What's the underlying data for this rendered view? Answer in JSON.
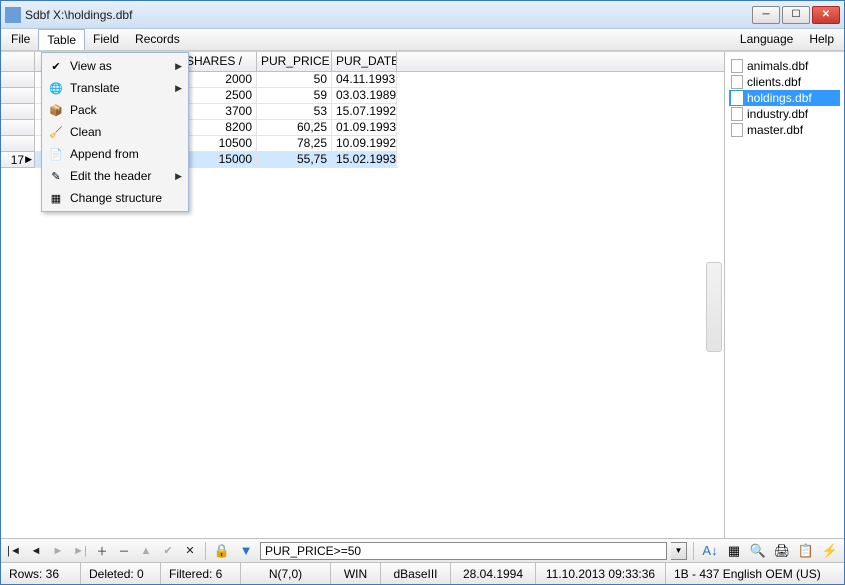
{
  "window": {
    "title": "Sdbf X:\\holdings.dbf"
  },
  "menubar": {
    "file": "File",
    "table": "Table",
    "field": "Field",
    "records": "Records",
    "language": "Language",
    "help": "Help"
  },
  "dropdown": {
    "view_as": "View as",
    "translate": "Translate",
    "pack": "Pack",
    "clean": "Clean",
    "append_from": "Append from",
    "edit_header": "Edit the header",
    "change_structure": "Change structure"
  },
  "grid": {
    "headers": {
      "shares": "SHARES   /",
      "pur_price": "PUR_PRICE",
      "pur_date": "PUR_DATE"
    },
    "rows": [
      {
        "shares": "2000",
        "price": "50",
        "date": "04.11.1993"
      },
      {
        "shares": "2500",
        "price": "59",
        "date": "03.03.1989"
      },
      {
        "shares": "3700",
        "price": "53",
        "date": "15.07.1992"
      },
      {
        "shares": "8200",
        "price": "60,25",
        "date": "01.09.1993"
      },
      {
        "shares": "10500",
        "price": "78,25",
        "date": "10.09.1992"
      },
      {
        "shares": "15000",
        "price": "55,75",
        "date": "15.02.1993"
      }
    ],
    "current_rownum": "17"
  },
  "files": {
    "items": [
      "animals.dbf",
      "clients.dbf",
      "holdings.dbf",
      "industry.dbf",
      "master.dbf"
    ],
    "selected_index": 2
  },
  "filter": {
    "value": "PUR_PRICE>=50"
  },
  "status": {
    "rows": "Rows: 36",
    "deleted": "Deleted: 0",
    "filtered": "Filtered: 6",
    "fieldtype": "N(7,0)",
    "os": "WIN",
    "dbtype": "dBaseIII",
    "date": "28.04.1994",
    "timestamp": "11.10.2013 09:33:36",
    "codepage": "1B - 437 English OEM (US)"
  }
}
